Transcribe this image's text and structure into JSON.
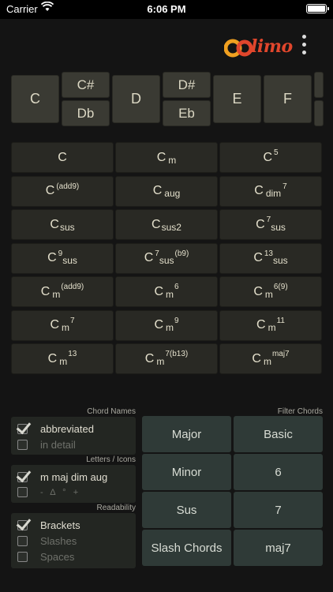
{
  "status": {
    "carrier": "Carrier",
    "time": "6:06 PM"
  },
  "brand": {
    "logo_text": "Oolimo",
    "logo_suffix": "limo"
  },
  "keys": {
    "c": "C",
    "csharp": "C#",
    "dflat": "Db",
    "d": "D",
    "dsharp": "D#",
    "eflat": "Eb",
    "e": "E",
    "f": "F"
  },
  "chords": {
    "c": {
      "root": "C"
    },
    "cm": {
      "root": "C",
      "sub": "m"
    },
    "c5": {
      "root": "C",
      "sup": "5"
    },
    "cadd9": {
      "root": "C",
      "sup": "(add9)"
    },
    "caug": {
      "root": "C",
      "sub": "aug"
    },
    "cdim7": {
      "root": "C",
      "sub": "dim",
      "sup": "7"
    },
    "csus": {
      "root": "C",
      "sub": "sus"
    },
    "csus2": {
      "root": "C",
      "sub": "sus2"
    },
    "c7sus": {
      "root": "C",
      "sup": "7",
      "sub": "sus"
    },
    "c9sus": {
      "root": "C",
      "sup": "9",
      "sub": "sus"
    },
    "c7susb9": {
      "root": "C",
      "sup": "7",
      "sub": "sus",
      "sup2": "(b9)"
    },
    "c13sus": {
      "root": "C",
      "sup": "13",
      "sub": "sus"
    },
    "cmadd9": {
      "root": "C",
      "sub": "m",
      "sup": "(add9)"
    },
    "cm6": {
      "root": "C",
      "sub": "m",
      "sup": "6"
    },
    "cm69": {
      "root": "C",
      "sub": "m",
      "sup": "6(9)"
    },
    "cm7": {
      "root": "C",
      "sub": "m",
      "sup": "7"
    },
    "cm9": {
      "root": "C",
      "sub": "m",
      "sup": "9"
    },
    "cm11": {
      "root": "C",
      "sub": "m",
      "sup": "11"
    },
    "cm13": {
      "root": "C",
      "sub": "m",
      "sup": "13"
    },
    "cm7b13": {
      "root": "C",
      "sub": "m",
      "sup": "7(b13)"
    },
    "cmmaj7": {
      "root": "C",
      "sub": "m",
      "sup": "maj7"
    }
  },
  "options": {
    "chord_names_label": "Chord Names",
    "abbreviated": "abbreviated",
    "in_detail": "in detail",
    "letters_icons_label": "Letters / Icons",
    "letters": "m maj dim aug",
    "icons": "-   Δ   °   +",
    "readability_label": "Readability",
    "brackets": "Brackets",
    "slashes": "Slashes",
    "spaces": "Spaces"
  },
  "filter": {
    "label": "Filter Chords",
    "major": "Major",
    "minor": "Minor",
    "sus": "Sus",
    "slash": "Slash Chords",
    "basic": "Basic",
    "six": "6",
    "seven": "7",
    "maj7": "maj7"
  },
  "colors": {
    "logo_accent": "#e0462c",
    "logo_ring": "#f0a020"
  }
}
